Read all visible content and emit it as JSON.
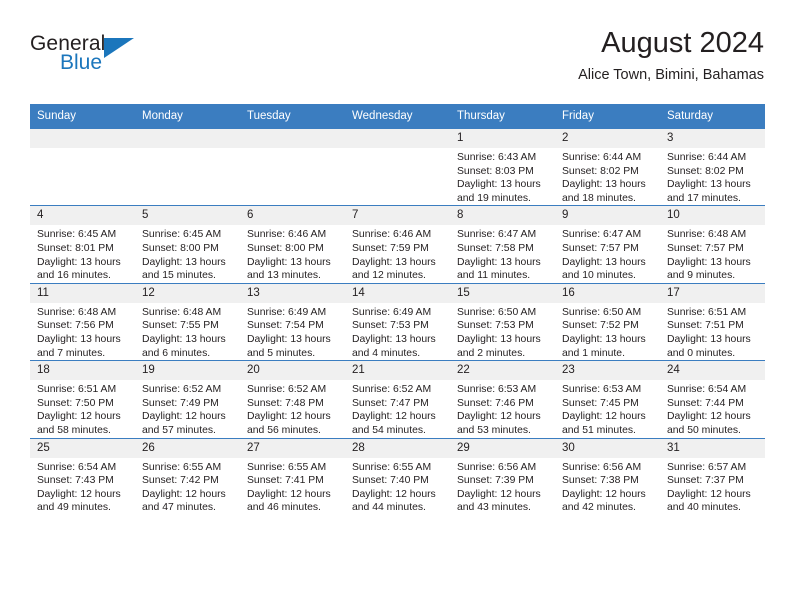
{
  "brand": {
    "name_part1": "General",
    "name_part2": "Blue",
    "logo_icon": "blue-triangle-logo"
  },
  "header": {
    "title": "August 2024",
    "location": "Alice Town, Bimini, Bahamas"
  },
  "colors": {
    "header_blue": "#3b7dc0",
    "brand_blue": "#1b76bc",
    "daynum_bg": "#f0f0f0",
    "text": "#231f20"
  },
  "weekdays": [
    "Sunday",
    "Monday",
    "Tuesday",
    "Wednesday",
    "Thursday",
    "Friday",
    "Saturday"
  ],
  "weeks": [
    [
      {
        "day": "",
        "lines": [
          "",
          "",
          "",
          ""
        ]
      },
      {
        "day": "",
        "lines": [
          "",
          "",
          "",
          ""
        ]
      },
      {
        "day": "",
        "lines": [
          "",
          "",
          "",
          ""
        ]
      },
      {
        "day": "",
        "lines": [
          "",
          "",
          "",
          ""
        ]
      },
      {
        "day": "1",
        "lines": [
          "Sunrise: 6:43 AM",
          "Sunset: 8:03 PM",
          "Daylight: 13 hours",
          "and 19 minutes."
        ]
      },
      {
        "day": "2",
        "lines": [
          "Sunrise: 6:44 AM",
          "Sunset: 8:02 PM",
          "Daylight: 13 hours",
          "and 18 minutes."
        ]
      },
      {
        "day": "3",
        "lines": [
          "Sunrise: 6:44 AM",
          "Sunset: 8:02 PM",
          "Daylight: 13 hours",
          "and 17 minutes."
        ]
      }
    ],
    [
      {
        "day": "4",
        "lines": [
          "Sunrise: 6:45 AM",
          "Sunset: 8:01 PM",
          "Daylight: 13 hours",
          "and 16 minutes."
        ]
      },
      {
        "day": "5",
        "lines": [
          "Sunrise: 6:45 AM",
          "Sunset: 8:00 PM",
          "Daylight: 13 hours",
          "and 15 minutes."
        ]
      },
      {
        "day": "6",
        "lines": [
          "Sunrise: 6:46 AM",
          "Sunset: 8:00 PM",
          "Daylight: 13 hours",
          "and 13 minutes."
        ]
      },
      {
        "day": "7",
        "lines": [
          "Sunrise: 6:46 AM",
          "Sunset: 7:59 PM",
          "Daylight: 13 hours",
          "and 12 minutes."
        ]
      },
      {
        "day": "8",
        "lines": [
          "Sunrise: 6:47 AM",
          "Sunset: 7:58 PM",
          "Daylight: 13 hours",
          "and 11 minutes."
        ]
      },
      {
        "day": "9",
        "lines": [
          "Sunrise: 6:47 AM",
          "Sunset: 7:57 PM",
          "Daylight: 13 hours",
          "and 10 minutes."
        ]
      },
      {
        "day": "10",
        "lines": [
          "Sunrise: 6:48 AM",
          "Sunset: 7:57 PM",
          "Daylight: 13 hours",
          "and 9 minutes."
        ]
      }
    ],
    [
      {
        "day": "11",
        "lines": [
          "Sunrise: 6:48 AM",
          "Sunset: 7:56 PM",
          "Daylight: 13 hours",
          "and 7 minutes."
        ]
      },
      {
        "day": "12",
        "lines": [
          "Sunrise: 6:48 AM",
          "Sunset: 7:55 PM",
          "Daylight: 13 hours",
          "and 6 minutes."
        ]
      },
      {
        "day": "13",
        "lines": [
          "Sunrise: 6:49 AM",
          "Sunset: 7:54 PM",
          "Daylight: 13 hours",
          "and 5 minutes."
        ]
      },
      {
        "day": "14",
        "lines": [
          "Sunrise: 6:49 AM",
          "Sunset: 7:53 PM",
          "Daylight: 13 hours",
          "and 4 minutes."
        ]
      },
      {
        "day": "15",
        "lines": [
          "Sunrise: 6:50 AM",
          "Sunset: 7:53 PM",
          "Daylight: 13 hours",
          "and 2 minutes."
        ]
      },
      {
        "day": "16",
        "lines": [
          "Sunrise: 6:50 AM",
          "Sunset: 7:52 PM",
          "Daylight: 13 hours",
          "and 1 minute."
        ]
      },
      {
        "day": "17",
        "lines": [
          "Sunrise: 6:51 AM",
          "Sunset: 7:51 PM",
          "Daylight: 13 hours",
          "and 0 minutes."
        ]
      }
    ],
    [
      {
        "day": "18",
        "lines": [
          "Sunrise: 6:51 AM",
          "Sunset: 7:50 PM",
          "Daylight: 12 hours",
          "and 58 minutes."
        ]
      },
      {
        "day": "19",
        "lines": [
          "Sunrise: 6:52 AM",
          "Sunset: 7:49 PM",
          "Daylight: 12 hours",
          "and 57 minutes."
        ]
      },
      {
        "day": "20",
        "lines": [
          "Sunrise: 6:52 AM",
          "Sunset: 7:48 PM",
          "Daylight: 12 hours",
          "and 56 minutes."
        ]
      },
      {
        "day": "21",
        "lines": [
          "Sunrise: 6:52 AM",
          "Sunset: 7:47 PM",
          "Daylight: 12 hours",
          "and 54 minutes."
        ]
      },
      {
        "day": "22",
        "lines": [
          "Sunrise: 6:53 AM",
          "Sunset: 7:46 PM",
          "Daylight: 12 hours",
          "and 53 minutes."
        ]
      },
      {
        "day": "23",
        "lines": [
          "Sunrise: 6:53 AM",
          "Sunset: 7:45 PM",
          "Daylight: 12 hours",
          "and 51 minutes."
        ]
      },
      {
        "day": "24",
        "lines": [
          "Sunrise: 6:54 AM",
          "Sunset: 7:44 PM",
          "Daylight: 12 hours",
          "and 50 minutes."
        ]
      }
    ],
    [
      {
        "day": "25",
        "lines": [
          "Sunrise: 6:54 AM",
          "Sunset: 7:43 PM",
          "Daylight: 12 hours",
          "and 49 minutes."
        ]
      },
      {
        "day": "26",
        "lines": [
          "Sunrise: 6:55 AM",
          "Sunset: 7:42 PM",
          "Daylight: 12 hours",
          "and 47 minutes."
        ]
      },
      {
        "day": "27",
        "lines": [
          "Sunrise: 6:55 AM",
          "Sunset: 7:41 PM",
          "Daylight: 12 hours",
          "and 46 minutes."
        ]
      },
      {
        "day": "28",
        "lines": [
          "Sunrise: 6:55 AM",
          "Sunset: 7:40 PM",
          "Daylight: 12 hours",
          "and 44 minutes."
        ]
      },
      {
        "day": "29",
        "lines": [
          "Sunrise: 6:56 AM",
          "Sunset: 7:39 PM",
          "Daylight: 12 hours",
          "and 43 minutes."
        ]
      },
      {
        "day": "30",
        "lines": [
          "Sunrise: 6:56 AM",
          "Sunset: 7:38 PM",
          "Daylight: 12 hours",
          "and 42 minutes."
        ]
      },
      {
        "day": "31",
        "lines": [
          "Sunrise: 6:57 AM",
          "Sunset: 7:37 PM",
          "Daylight: 12 hours",
          "and 40 minutes."
        ]
      }
    ]
  ]
}
